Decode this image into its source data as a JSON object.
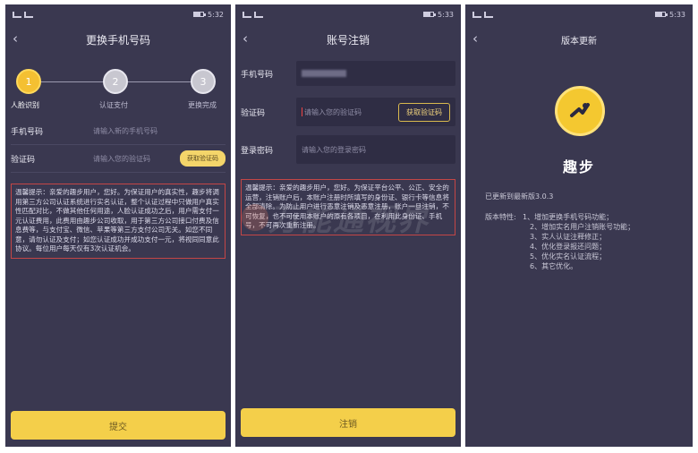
{
  "status_bars": [
    {
      "time": "5:32"
    },
    {
      "time": "5:33"
    },
    {
      "time": "5:33"
    }
  ],
  "screen1": {
    "title": "更换手机号码",
    "steps": [
      {
        "num": "1",
        "label": "人脸识别"
      },
      {
        "num": "2",
        "label": "认证支付"
      },
      {
        "num": "3",
        "label": "更换完成"
      }
    ],
    "phone_label": "手机号码",
    "phone_placeholder": "请输入新的手机号码",
    "code_label": "验证码",
    "code_placeholder": "请输入您的验证码",
    "get_code_button": "获取验证码",
    "tip": "温馨提示：亲爱的趣步用户，您好。为保证用户的真实性，趣步将调用第三方公司认证系统进行实名认证，整个认证过程中只做用户真实性匹配对比，不做其他任何用途，人脸认证成功之后，用户需支付一元认证费用，此费用由趣步公司收取，用于第三方公司接口付费及信息费等，与支付宝、微信、苹果等第三方支付公司无关。如您不同意，请勿认证及支付；如您认证成功并成功支付一元，将视同同意此协议。每位用户每天仅有3次认证机会。",
    "submit_button": "提交"
  },
  "screen2": {
    "title": "账号注销",
    "phone_label": "手机号码",
    "phone_value": "",
    "code_label": "验证码",
    "code_placeholder": "请输入您的验证码",
    "get_code_button": "获取验证码",
    "password_label": "登录密码",
    "password_placeholder": "请输入您的登录密码",
    "tip": "温馨提示：亲爱的趣步用户，您好。为保证平台公平、公正、安全的运营，注销账户后，本账户注册时所填写的身份证、银行卡等信息将全部清除。为防止用户进行恶意注销及恶意注册，账户一旦注销，不可恢复，也不可使用本账户的原有各项目，在利用此身份证、手机号，不可再次重新注册。",
    "cancel_button": "注销"
  },
  "screen3": {
    "title": "版本更新",
    "app_name": "趣步",
    "version_text": "已更新到最新版3.0.3",
    "features_title": "版本特性:",
    "features": [
      "1、增加更换手机号码功能；",
      "2、增加实名用户注销账号功能；",
      "3、实人认证注释修正；",
      "4、优化登录报还问题；",
      "5、优化实名认证流程；",
      "6、其它优化。"
    ]
  },
  "watermark": "万能通视界",
  "colors": {
    "background": "#3a3850",
    "accent": "#f4cf4a",
    "tip_border": "#c44646"
  }
}
